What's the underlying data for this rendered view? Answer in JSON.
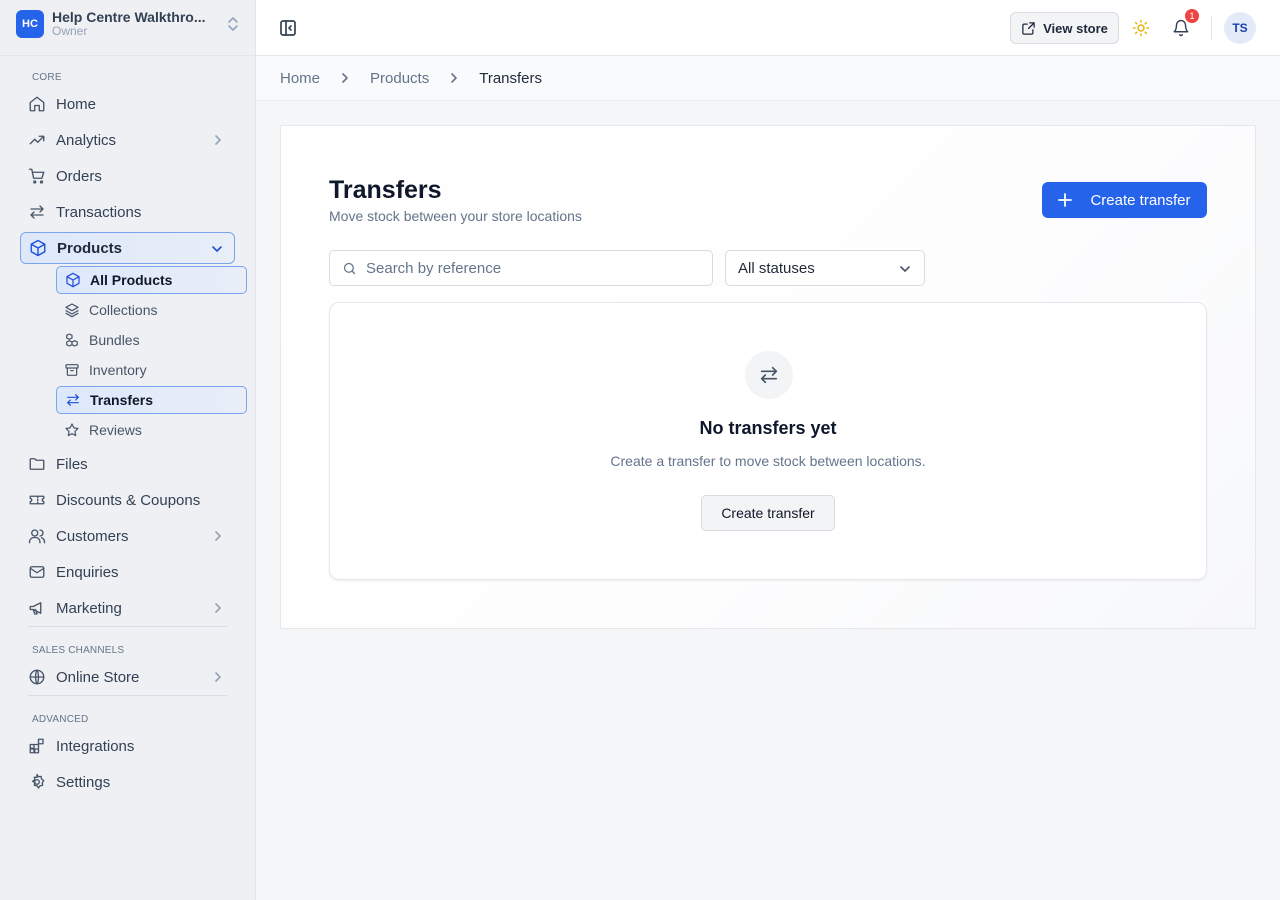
{
  "org": {
    "initials": "HC",
    "name": "Help Centre Walkthro...",
    "role": "Owner"
  },
  "sidebar": {
    "sections": {
      "core": "CORE",
      "sales": "SALES CHANNELS",
      "advanced": "ADVANCED"
    },
    "items": {
      "home": "Home",
      "analytics": "Analytics",
      "orders": "Orders",
      "transactions": "Transactions",
      "products": "Products",
      "files": "Files",
      "discounts": "Discounts & Coupons",
      "customers": "Customers",
      "enquiries": "Enquiries",
      "marketing": "Marketing",
      "online_store": "Online Store",
      "integrations": "Integrations",
      "settings": "Settings"
    },
    "product_sub": {
      "all_products": "All Products",
      "collections": "Collections",
      "bundles": "Bundles",
      "inventory": "Inventory",
      "transfers": "Transfers",
      "reviews": "Reviews"
    }
  },
  "header": {
    "view_store": "View store",
    "notification_count": "1",
    "avatar_initials": "TS"
  },
  "breadcrumb": {
    "home": "Home",
    "products": "Products",
    "current": "Transfers"
  },
  "main": {
    "title": "Transfers",
    "subtitle": "Move stock between your store locations",
    "create_button": "Create transfer",
    "search_placeholder": "Search by reference",
    "status_filter": "All statuses",
    "empty": {
      "title": "No transfers yet",
      "text": "Create a transfer to move stock between locations.",
      "button": "Create transfer"
    }
  },
  "colors": {
    "primary": "#2563eb",
    "badge": "#ef4444",
    "active_border": "#7aa5ee",
    "sun": "#eab308"
  }
}
